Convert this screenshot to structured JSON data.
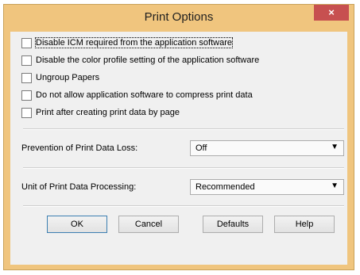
{
  "dialog": {
    "title": "Print Options",
    "close_glyph": "×"
  },
  "options": [
    {
      "label": "Disable ICM required from the application software",
      "checked": false
    },
    {
      "label": "Disable the color profile setting of the application software",
      "checked": false
    },
    {
      "label": "Ungroup Papers",
      "checked": false
    },
    {
      "label": "Do not allow application software to compress print data",
      "checked": false
    },
    {
      "label": "Print after creating print data by page",
      "checked": false
    }
  ],
  "prevention": {
    "label": "Prevention of Print Data Loss:",
    "value": "Off"
  },
  "unit": {
    "label": "Unit of Print Data Processing:",
    "value": "Recommended"
  },
  "dropdown_glyph": "▼",
  "buttons": {
    "ok": "OK",
    "cancel": "Cancel",
    "defaults": "Defaults",
    "help": "Help"
  },
  "colors": {
    "frame": "#f0c57e",
    "close": "#c75050",
    "client": "#f0f0f0"
  }
}
